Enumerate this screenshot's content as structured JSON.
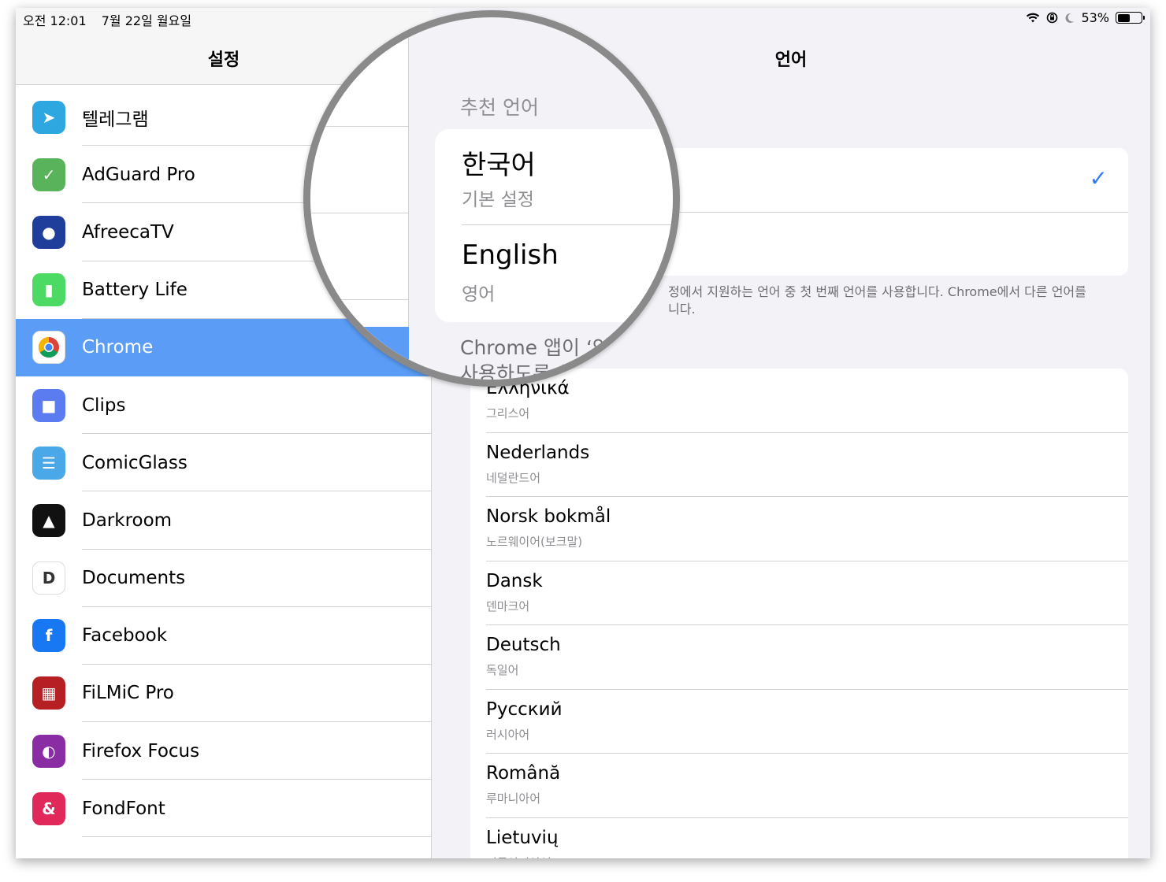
{
  "status_bar": {
    "time": "오전 12:01",
    "date": "7월 22일 월요일",
    "battery": "53%",
    "battery_level": 0.53
  },
  "sidebar": {
    "title": "설정",
    "items": [
      {
        "label": "텔레그램",
        "icon": "telegram-icon",
        "color": "#2ea6e0"
      },
      {
        "label": "AdGuard Pro",
        "icon": "adguard-shield-icon",
        "color": "#58b35a"
      },
      {
        "label": "AfreecaTV",
        "icon": "afreecatv-icon",
        "color": "#1f3d9a"
      },
      {
        "label": "Battery Life",
        "icon": "battery-life-icon",
        "color": "#4cd964"
      },
      {
        "label": "Chrome",
        "icon": "chrome-icon",
        "color": "#ffffff",
        "selected": true
      },
      {
        "label": "Clips",
        "icon": "clips-icon",
        "color": "#5a7cf0"
      },
      {
        "label": "ComicGlass",
        "icon": "comicglass-icon",
        "color": "#4aa8e8"
      },
      {
        "label": "Darkroom",
        "icon": "darkroom-icon",
        "color": "#111111"
      },
      {
        "label": "Documents",
        "icon": "documents-icon",
        "color": "#ffffff"
      },
      {
        "label": "Facebook",
        "icon": "facebook-icon",
        "color": "#1877f2"
      },
      {
        "label": "FiLMiC Pro",
        "icon": "filmic-pro-icon",
        "color": "#b62025"
      },
      {
        "label": "Firefox Focus",
        "icon": "firefox-focus-icon",
        "color": "#8a2da5"
      },
      {
        "label": "FondFont",
        "icon": "fondfont-icon",
        "color": "#e0285a"
      }
    ]
  },
  "detail": {
    "title": "언어",
    "recommended_label": "추천 언어",
    "preferred": [
      {
        "title": "한국어",
        "subtitle": "기본 설정",
        "checked": true
      },
      {
        "title": "English",
        "subtitle": "영어",
        "checked": false
      }
    ],
    "footer_line1": "정에서 지원하는 언어 중 첫 번째 언어를 사용합니다. Chrome에서 다른 언어를",
    "footer_line2": "니다.",
    "other_label_line1": "Chrome 앱이 ‘언",
    "other_label_line2": "사용하도록 설",
    "languages": [
      {
        "title": "Ελληνικά",
        "subtitle": "그리스어"
      },
      {
        "title": "Nederlands",
        "subtitle": "네덜란드어"
      },
      {
        "title": "Norsk bokmål",
        "subtitle": "노르웨이어(보크말)"
      },
      {
        "title": "Dansk",
        "subtitle": "덴마크어"
      },
      {
        "title": "Deutsch",
        "subtitle": "독일어"
      },
      {
        "title": "Русский",
        "subtitle": "러시아어"
      },
      {
        "title": "Română",
        "subtitle": "루마니아어"
      },
      {
        "title": "Lietuvių",
        "subtitle": "리투아니아어"
      }
    ],
    "accent_color": "#2f7cf6",
    "selection_color": "#5b9df6"
  }
}
